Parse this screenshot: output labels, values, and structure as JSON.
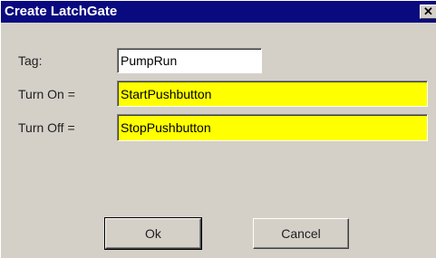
{
  "window": {
    "title": "Create LatchGate",
    "close_glyph": "✕",
    "close_icon": "close-icon"
  },
  "form": {
    "tag": {
      "label": "Tag:",
      "value": "PumpRun"
    },
    "turn_on": {
      "label": "Turn On =",
      "value": "StartPushbutton"
    },
    "turn_off": {
      "label": "Turn Off =",
      "value": "StopPushbutton"
    }
  },
  "buttons": {
    "ok_label": "Ok",
    "cancel_label": "Cancel"
  },
  "colors": {
    "titlebar": "#0a0a80",
    "dialog_bg": "#d4d0c8",
    "highlight_field": "#ffff00",
    "tag_field": "#ffffff"
  }
}
